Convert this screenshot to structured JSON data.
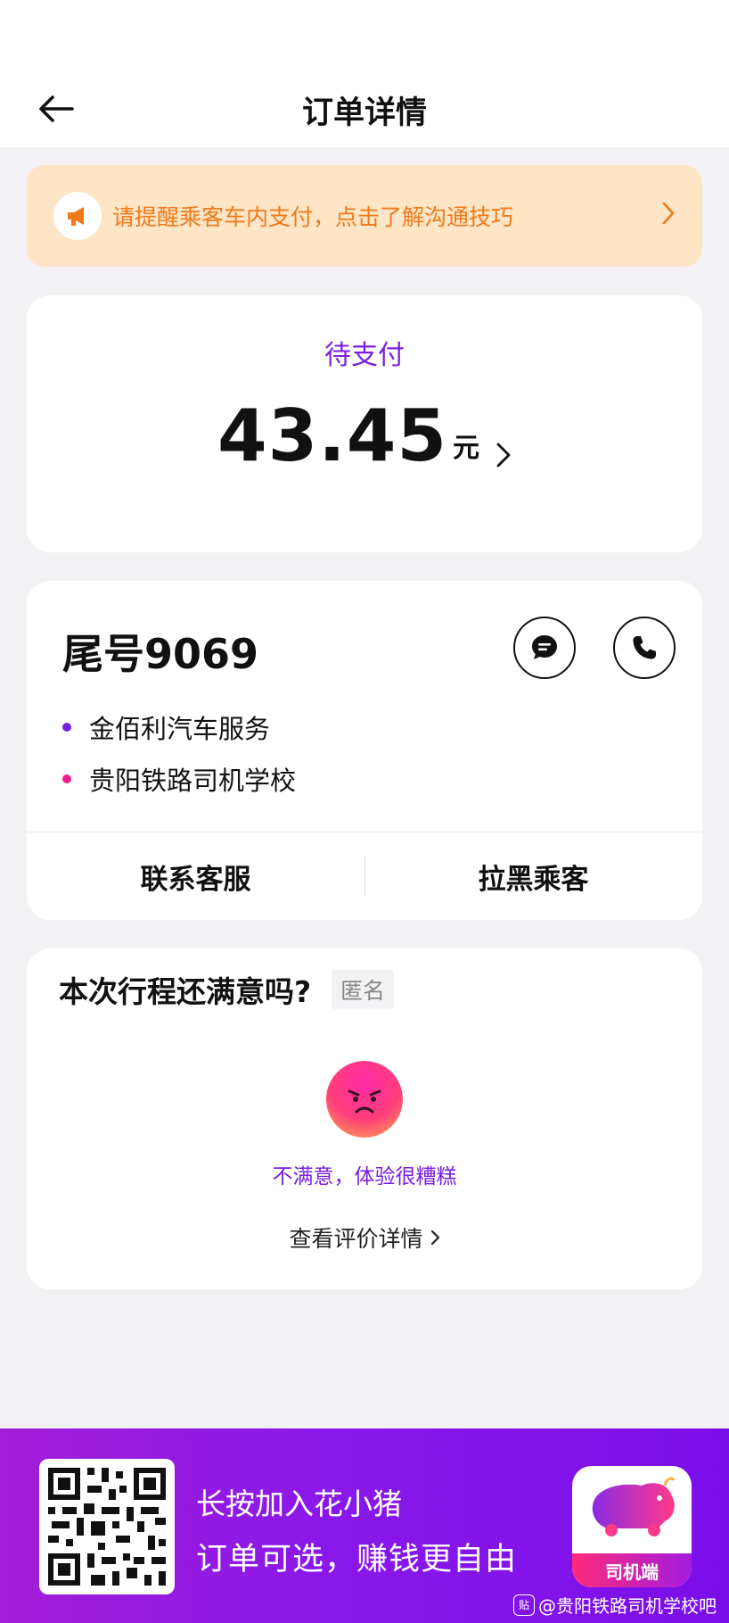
{
  "header": {
    "title": "订单详情"
  },
  "notice": {
    "text": "请提醒乘客车内支付，点击了解沟通技巧",
    "color": "#ef7a1a",
    "background": "#fde5c6",
    "icon": "megaphone-icon"
  },
  "status": {
    "label": "待支付",
    "amount": "43.45",
    "unit": "元",
    "accent": "#7a1ee0"
  },
  "passenger": {
    "name": "尾号9069",
    "route": [
      {
        "place": "金佰利汽车服务",
        "dot_color": "#7a1ee0"
      },
      {
        "place": "贵阳铁路司机学校",
        "dot_color": "#ee1f8a"
      }
    ],
    "actions": {
      "contact_service": "联系客服",
      "block_passenger": "拉黑乘客"
    }
  },
  "rating": {
    "question": "本次行程还满意吗?",
    "anonymous_tag": "匿名",
    "result": "不满意，体验很糟糕",
    "detail_link": "查看评价详情"
  },
  "promo": {
    "line1": "长按加入花小猪",
    "line2": "订单可选，赚钱更自由",
    "app_badge": "司机端"
  },
  "watermark": {
    "icon_text": "贴",
    "text": "@贵阳铁路司机学校吧"
  }
}
